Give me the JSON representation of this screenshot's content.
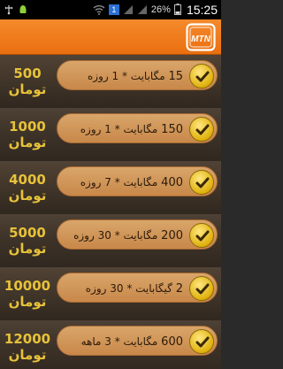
{
  "status_bar": {
    "notification_badge": "1",
    "battery_percent": "26%",
    "time": "15:25"
  },
  "app_bar": {
    "logo_text": "MTN",
    "accent_color": "#f07a1c"
  },
  "packages": [
    {
      "price_amount": "500",
      "price_unit": "تومان",
      "size": "15",
      "label": "مگابایت * 1 روزه"
    },
    {
      "price_amount": "1000",
      "price_unit": "تومان",
      "size": "150",
      "label": "مگابایت * 1 روزه"
    },
    {
      "price_amount": "4000",
      "price_unit": "تومان",
      "size": "400",
      "label": "مگابایت * 7 روزه"
    },
    {
      "price_amount": "5000",
      "price_unit": "تومان",
      "size": "200",
      "label": "مگابایت * 30 روزه"
    },
    {
      "price_amount": "10000",
      "price_unit": "تومان",
      "size": "2",
      "label": "گیگابایت * 30 روزه"
    },
    {
      "price_amount": "12000",
      "price_unit": "تومان",
      "size": "600",
      "label": "مگابایت * 3 ماهه"
    }
  ]
}
